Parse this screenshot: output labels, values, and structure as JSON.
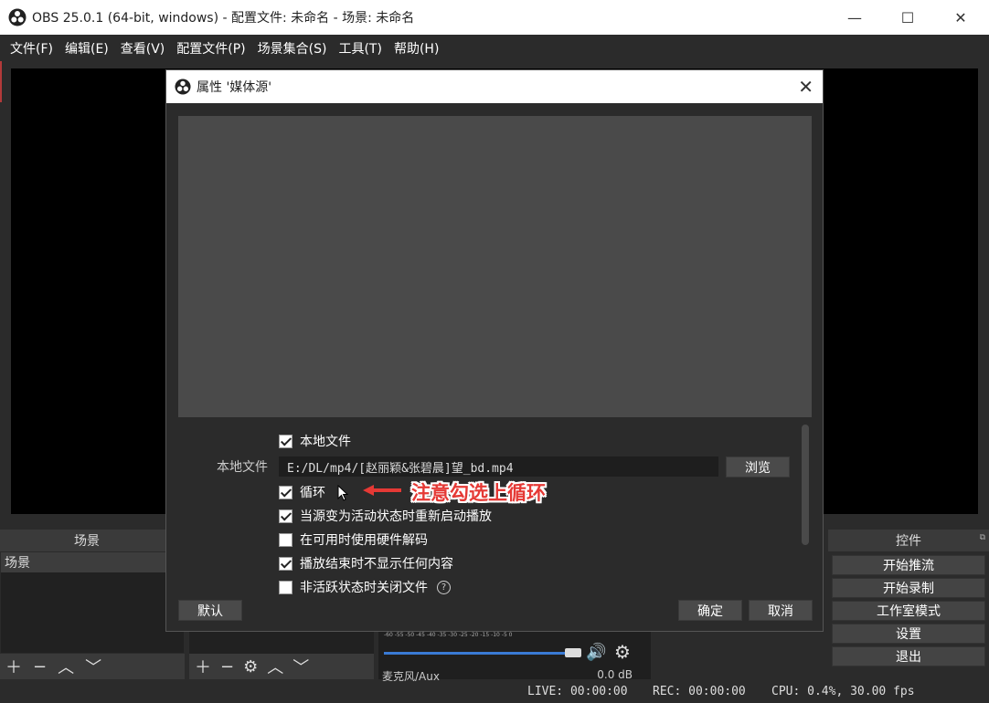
{
  "window": {
    "title": "OBS 25.0.1 (64-bit, windows) - 配置文件: 未命名 - 场景: 未命名",
    "logo_icon": "obs-logo-icon"
  },
  "menu": [
    "文件(F)",
    "编辑(E)",
    "查看(V)",
    "配置文件(P)",
    "场景集合(S)",
    "工具(T)",
    "帮助(H)"
  ],
  "docks": {
    "scenes_title": "场景",
    "scenes_items": [
      "场景"
    ],
    "controls_title": "控件",
    "controls_buttons": [
      "开始推流",
      "开始录制",
      "工作室模式",
      "设置",
      "退出"
    ]
  },
  "mixer": {
    "ticks": "-60  -55  -50  -45  -40  -35  -30  -25  -20  -15  -10   -5    0",
    "source_name": "麦克风/Aux",
    "db": "0.0 dB"
  },
  "status": {
    "live": "LIVE: 00:00:00",
    "rec": "REC: 00:00:00",
    "cpu": "CPU: 0.4%, 30.00 fps"
  },
  "dialog": {
    "title": "属性 '媒体源'",
    "local_file_checkbox": "本地文件",
    "local_file_label": "本地文件",
    "file_path": "E:/DL/mp4/[赵丽颖&张碧晨]望_bd.mp4",
    "browse": "浏览",
    "checkboxes": [
      {
        "label": "循环",
        "checked": true
      },
      {
        "label": "当源变为活动状态时重新启动播放",
        "checked": true
      },
      {
        "label": "在可用时使用硬件解码",
        "checked": false
      },
      {
        "label": "播放结束时不显示任何内容",
        "checked": true
      },
      {
        "label": "非活跃状态时关闭文件",
        "checked": false
      }
    ],
    "default_btn": "默认",
    "ok_btn": "确定",
    "cancel_btn": "取消"
  },
  "annotation": {
    "text": "注意勾选上循环",
    "color": "#e53935"
  }
}
